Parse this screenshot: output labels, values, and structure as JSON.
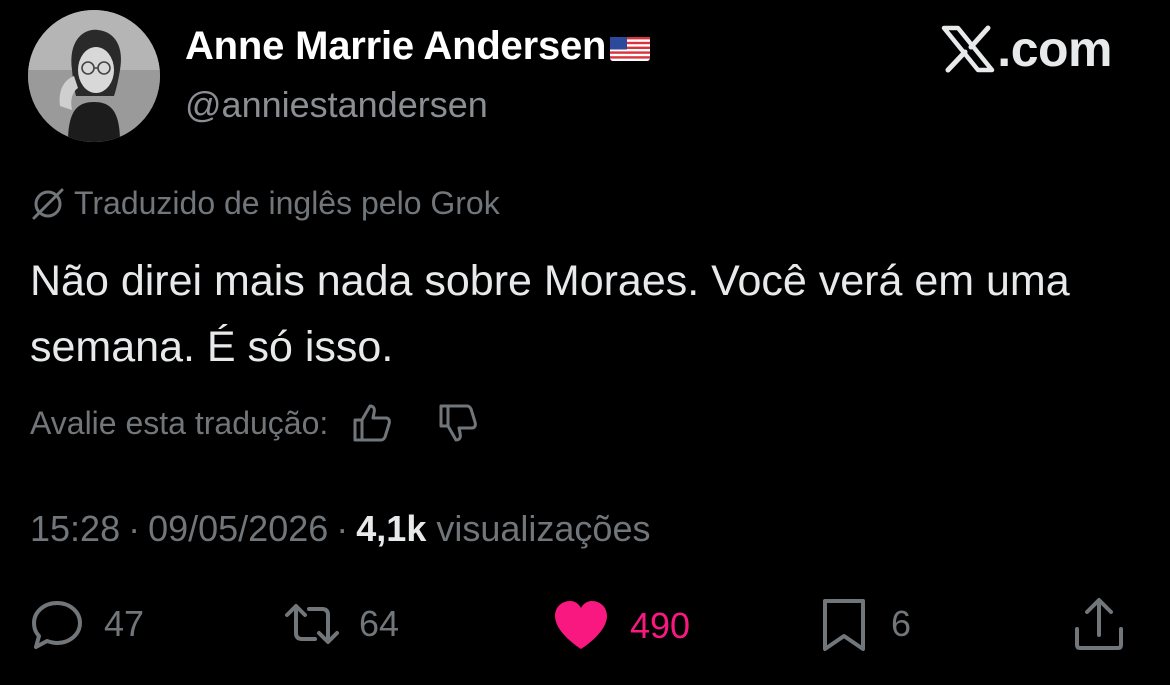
{
  "header": {
    "display_name": "Anne Marrie Andersen",
    "flag_icon": "us-flag-icon",
    "handle": "@anniestandersen",
    "brand_text": ".com"
  },
  "translation": {
    "notice": "Traduzido de inglês pelo Grok",
    "icon": "grok-icon"
  },
  "tweet": {
    "text": "Não direi mais nada sobre Moraes. Você verá em uma semana. É só isso."
  },
  "rating": {
    "label": "Avalie esta tradução:",
    "thumbs_up_icon": "thumbs-up-icon",
    "thumbs_down_icon": "thumbs-down-icon"
  },
  "meta": {
    "time": "15:28",
    "separator": "·",
    "date": "09/05/2026",
    "views_count": "4,1k",
    "views_label": "visualizações"
  },
  "actions": {
    "replies": "47",
    "reposts": "64",
    "likes": "490",
    "bookmarks": "6"
  },
  "colors": {
    "background": "#000000",
    "primary_text": "#e7e9ea",
    "secondary_text": "#71767b",
    "like_accent": "#f91880"
  }
}
